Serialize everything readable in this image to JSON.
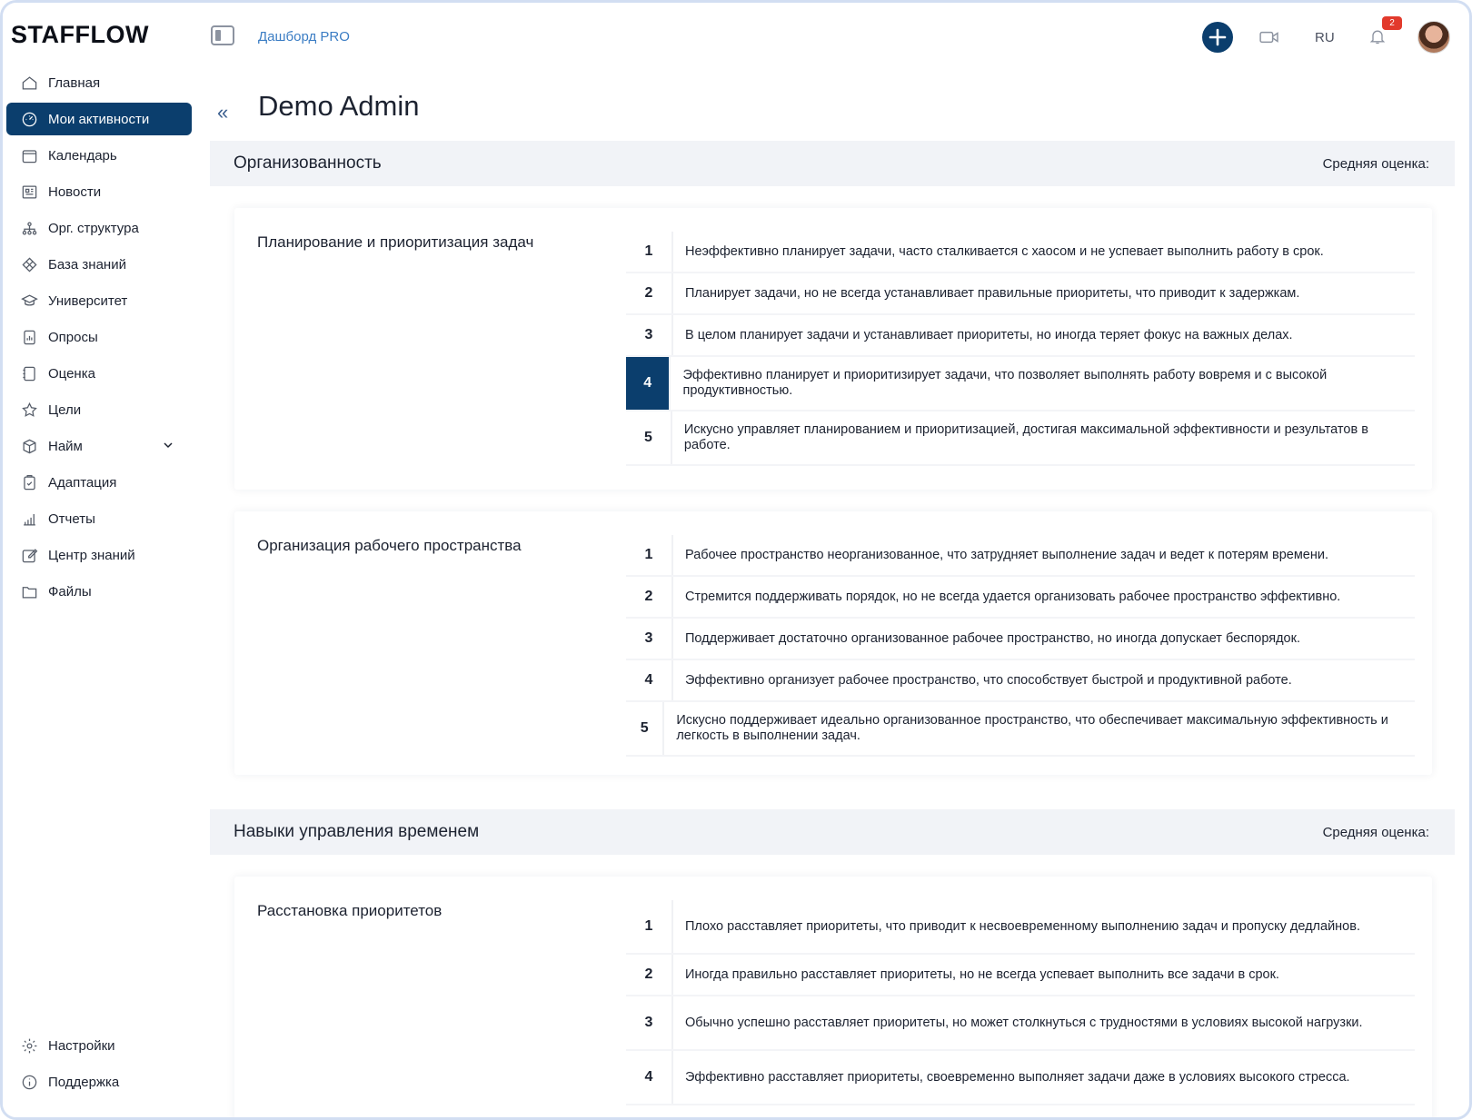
{
  "app": {
    "logo": "STAFFLOW"
  },
  "header": {
    "breadcrumb": "Дашборд PRO",
    "lang": "RU",
    "notifications_count": "2"
  },
  "sidebar": {
    "items": [
      {
        "label": "Главная",
        "icon": "home-icon"
      },
      {
        "label": "Мои активности",
        "icon": "gauge-icon",
        "active": true
      },
      {
        "label": "Календарь",
        "icon": "calendar-icon"
      },
      {
        "label": "Новости",
        "icon": "newspaper-icon"
      },
      {
        "label": "Орг. структура",
        "icon": "org-structure-icon"
      },
      {
        "label": "База знаний",
        "icon": "diamond-icon"
      },
      {
        "label": "Университет",
        "icon": "graduation-cap-icon"
      },
      {
        "label": "Опросы",
        "icon": "survey-icon"
      },
      {
        "label": "Оценка",
        "icon": "notebook-icon"
      },
      {
        "label": "Цели",
        "icon": "star-icon"
      },
      {
        "label": "Найм",
        "icon": "cube-icon",
        "expandable": true
      },
      {
        "label": "Адаптация",
        "icon": "clipboard-icon"
      },
      {
        "label": "Отчеты",
        "icon": "bar-chart-icon"
      },
      {
        "label": "Центр знаний",
        "icon": "edit-icon"
      },
      {
        "label": "Файлы",
        "icon": "folder-icon"
      }
    ],
    "bottom": [
      {
        "label": "Настройки",
        "icon": "gear-icon"
      },
      {
        "label": "Поддержка",
        "icon": "info-icon"
      }
    ]
  },
  "page": {
    "title": "Demo Admin"
  },
  "sections": [
    {
      "title": "Организованность",
      "avg_label": "Средняя оценка:",
      "criteria": [
        {
          "title": "Планирование и приоритизация задач",
          "selected": 4,
          "levels": [
            {
              "n": "1",
              "text": "Неэффективно планирует задачи, часто сталкивается с хаосом и не успевает выполнить работу в срок."
            },
            {
              "n": "2",
              "text": "Планирует задачи, но не всегда устанавливает правильные приоритеты, что приводит к задержкам."
            },
            {
              "n": "3",
              "text": "В целом планирует задачи и устанавливает приоритеты, но иногда теряет фокус на важных делах."
            },
            {
              "n": "4",
              "text": "Эффективно планирует и приоритизирует задачи, что позволяет выполнять работу вовремя и с высокой продуктивностью."
            },
            {
              "n": "5",
              "text": "Искусно управляет планированием и приоритизацией, достигая максимальной эффективности и результатов в работе."
            }
          ]
        },
        {
          "title": "Организация рабочего пространства",
          "selected": null,
          "levels": [
            {
              "n": "1",
              "text": "Рабочее пространство неорганизованное, что затрудняет выполнение задач и ведет к потерям времени."
            },
            {
              "n": "2",
              "text": "Стремится поддерживать порядок, но не всегда удается организовать рабочее пространство эффективно."
            },
            {
              "n": "3",
              "text": "Поддерживает достаточно организованное рабочее пространство, но иногда допускает беспорядок."
            },
            {
              "n": "4",
              "text": "Эффективно организует рабочее пространство, что способствует быстрой и продуктивной работе."
            },
            {
              "n": "5",
              "text": "Искусно поддерживает идеально организованное пространство, что обеспечивает максимальную эффективность и легкость в выполнении задач."
            }
          ]
        }
      ]
    },
    {
      "title": "Навыки управления временем",
      "avg_label": "Средняя оценка:",
      "criteria": [
        {
          "title": "Расстановка приоритетов",
          "selected": null,
          "levels": [
            {
              "n": "1",
              "text": "Плохо расставляет приоритеты, что приводит к несвоевременному выполнению задач и пропуску дедлайнов."
            },
            {
              "n": "2",
              "text": "Иногда правильно расставляет приоритеты, но не всегда успевает выполнить все задачи в срок."
            },
            {
              "n": "3",
              "text": "Обычно успешно расставляет приоритеты, но может столкнуться с трудностями в условиях высокой нагрузки."
            },
            {
              "n": "4",
              "text": "Эффективно расставляет приоритеты, своевременно выполняет задачи даже в условиях высокого стресса."
            }
          ]
        }
      ]
    }
  ],
  "colors": {
    "accent": "#0b3e6d",
    "link": "#3b7dc4",
    "badge": "#e23a2c",
    "section_bg": "#f1f3f7"
  }
}
